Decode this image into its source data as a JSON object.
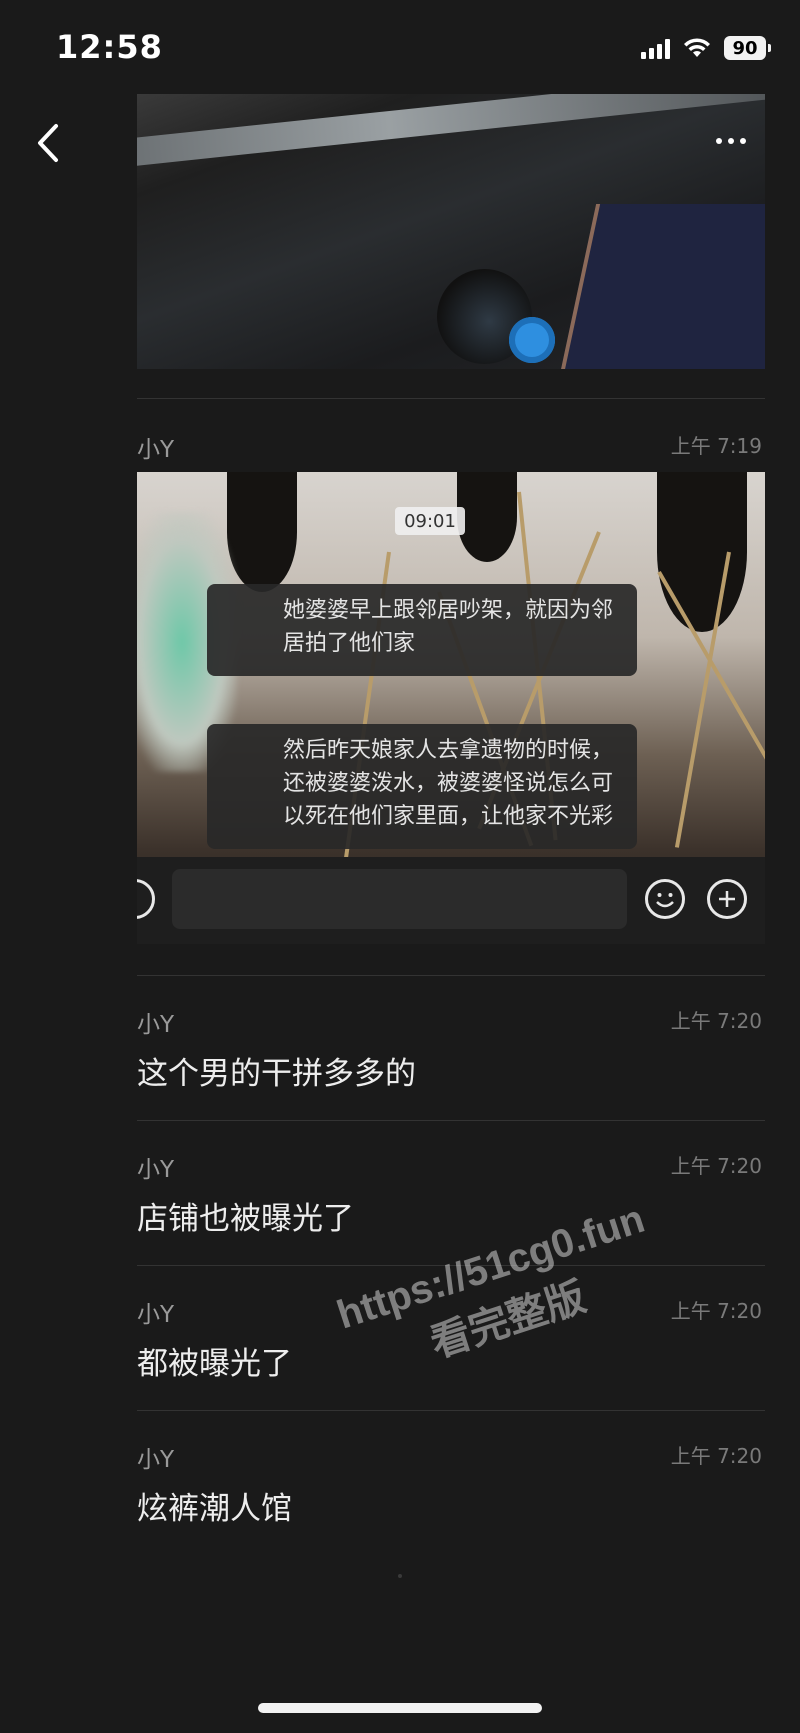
{
  "status_bar": {
    "time": "12:58",
    "battery": "90"
  },
  "icons": {
    "back": "chevron-left-icon",
    "more": "more-dots-icon",
    "emoji": "emoji-icon",
    "add": "plus-circle-icon"
  },
  "posts": [
    {
      "sender": "小Y",
      "time": "上午 7:19",
      "screenshot": {
        "clock": "09:01",
        "bubble_1": "她婆婆早上跟邻居吵架，就因为邻居拍了他们家",
        "bubble_2": "然后昨天娘家人去拿遗物的时候，还被婆婆泼水，被婆婆怪说怎么可以死在他们家里面，让他家不光彩"
      }
    },
    {
      "sender": "小Y",
      "time": "上午 7:20",
      "text": "这个男的干拼多多的"
    },
    {
      "sender": "小Y",
      "time": "上午 7:20",
      "text": "店铺也被曝光了"
    },
    {
      "sender": "小Y",
      "time": "上午 7:20",
      "text": "都被曝光了"
    },
    {
      "sender": "小Y",
      "time": "上午 7:20",
      "text": "炫裤潮人馆"
    }
  ],
  "watermark": {
    "line1": "https://51cg0.fun",
    "line2": "看完整版"
  }
}
